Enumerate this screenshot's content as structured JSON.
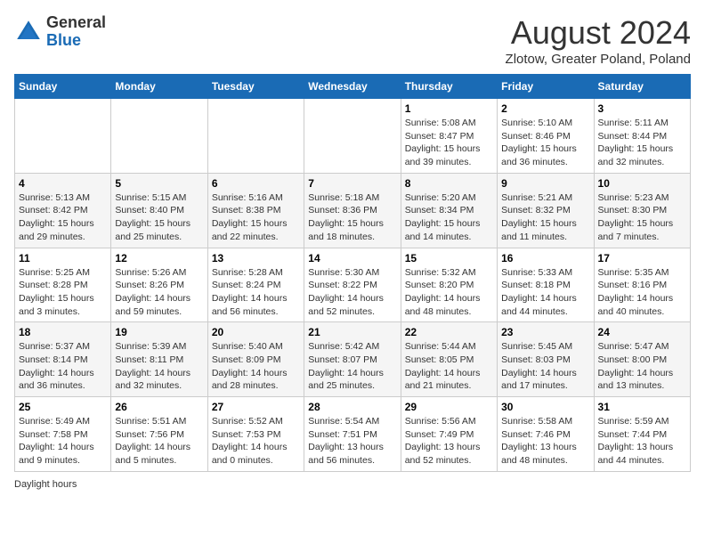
{
  "header": {
    "logo_general": "General",
    "logo_blue": "Blue",
    "month_title": "August 2024",
    "subtitle": "Zlotow, Greater Poland, Poland"
  },
  "days_of_week": [
    "Sunday",
    "Monday",
    "Tuesday",
    "Wednesday",
    "Thursday",
    "Friday",
    "Saturday"
  ],
  "weeks": [
    [
      {
        "day": "",
        "info": ""
      },
      {
        "day": "",
        "info": ""
      },
      {
        "day": "",
        "info": ""
      },
      {
        "day": "",
        "info": ""
      },
      {
        "day": "1",
        "info": "Sunrise: 5:08 AM\nSunset: 8:47 PM\nDaylight: 15 hours\nand 39 minutes."
      },
      {
        "day": "2",
        "info": "Sunrise: 5:10 AM\nSunset: 8:46 PM\nDaylight: 15 hours\nand 36 minutes."
      },
      {
        "day": "3",
        "info": "Sunrise: 5:11 AM\nSunset: 8:44 PM\nDaylight: 15 hours\nand 32 minutes."
      }
    ],
    [
      {
        "day": "4",
        "info": "Sunrise: 5:13 AM\nSunset: 8:42 PM\nDaylight: 15 hours\nand 29 minutes."
      },
      {
        "day": "5",
        "info": "Sunrise: 5:15 AM\nSunset: 8:40 PM\nDaylight: 15 hours\nand 25 minutes."
      },
      {
        "day": "6",
        "info": "Sunrise: 5:16 AM\nSunset: 8:38 PM\nDaylight: 15 hours\nand 22 minutes."
      },
      {
        "day": "7",
        "info": "Sunrise: 5:18 AM\nSunset: 8:36 PM\nDaylight: 15 hours\nand 18 minutes."
      },
      {
        "day": "8",
        "info": "Sunrise: 5:20 AM\nSunset: 8:34 PM\nDaylight: 15 hours\nand 14 minutes."
      },
      {
        "day": "9",
        "info": "Sunrise: 5:21 AM\nSunset: 8:32 PM\nDaylight: 15 hours\nand 11 minutes."
      },
      {
        "day": "10",
        "info": "Sunrise: 5:23 AM\nSunset: 8:30 PM\nDaylight: 15 hours\nand 7 minutes."
      }
    ],
    [
      {
        "day": "11",
        "info": "Sunrise: 5:25 AM\nSunset: 8:28 PM\nDaylight: 15 hours\nand 3 minutes."
      },
      {
        "day": "12",
        "info": "Sunrise: 5:26 AM\nSunset: 8:26 PM\nDaylight: 14 hours\nand 59 minutes."
      },
      {
        "day": "13",
        "info": "Sunrise: 5:28 AM\nSunset: 8:24 PM\nDaylight: 14 hours\nand 56 minutes."
      },
      {
        "day": "14",
        "info": "Sunrise: 5:30 AM\nSunset: 8:22 PM\nDaylight: 14 hours\nand 52 minutes."
      },
      {
        "day": "15",
        "info": "Sunrise: 5:32 AM\nSunset: 8:20 PM\nDaylight: 14 hours\nand 48 minutes."
      },
      {
        "day": "16",
        "info": "Sunrise: 5:33 AM\nSunset: 8:18 PM\nDaylight: 14 hours\nand 44 minutes."
      },
      {
        "day": "17",
        "info": "Sunrise: 5:35 AM\nSunset: 8:16 PM\nDaylight: 14 hours\nand 40 minutes."
      }
    ],
    [
      {
        "day": "18",
        "info": "Sunrise: 5:37 AM\nSunset: 8:14 PM\nDaylight: 14 hours\nand 36 minutes."
      },
      {
        "day": "19",
        "info": "Sunrise: 5:39 AM\nSunset: 8:11 PM\nDaylight: 14 hours\nand 32 minutes."
      },
      {
        "day": "20",
        "info": "Sunrise: 5:40 AM\nSunset: 8:09 PM\nDaylight: 14 hours\nand 28 minutes."
      },
      {
        "day": "21",
        "info": "Sunrise: 5:42 AM\nSunset: 8:07 PM\nDaylight: 14 hours\nand 25 minutes."
      },
      {
        "day": "22",
        "info": "Sunrise: 5:44 AM\nSunset: 8:05 PM\nDaylight: 14 hours\nand 21 minutes."
      },
      {
        "day": "23",
        "info": "Sunrise: 5:45 AM\nSunset: 8:03 PM\nDaylight: 14 hours\nand 17 minutes."
      },
      {
        "day": "24",
        "info": "Sunrise: 5:47 AM\nSunset: 8:00 PM\nDaylight: 14 hours\nand 13 minutes."
      }
    ],
    [
      {
        "day": "25",
        "info": "Sunrise: 5:49 AM\nSunset: 7:58 PM\nDaylight: 14 hours\nand 9 minutes."
      },
      {
        "day": "26",
        "info": "Sunrise: 5:51 AM\nSunset: 7:56 PM\nDaylight: 14 hours\nand 5 minutes."
      },
      {
        "day": "27",
        "info": "Sunrise: 5:52 AM\nSunset: 7:53 PM\nDaylight: 14 hours\nand 0 minutes."
      },
      {
        "day": "28",
        "info": "Sunrise: 5:54 AM\nSunset: 7:51 PM\nDaylight: 13 hours\nand 56 minutes."
      },
      {
        "day": "29",
        "info": "Sunrise: 5:56 AM\nSunset: 7:49 PM\nDaylight: 13 hours\nand 52 minutes."
      },
      {
        "day": "30",
        "info": "Sunrise: 5:58 AM\nSunset: 7:46 PM\nDaylight: 13 hours\nand 48 minutes."
      },
      {
        "day": "31",
        "info": "Sunrise: 5:59 AM\nSunset: 7:44 PM\nDaylight: 13 hours\nand 44 minutes."
      }
    ]
  ],
  "footer": {
    "daylight_label": "Daylight hours"
  }
}
